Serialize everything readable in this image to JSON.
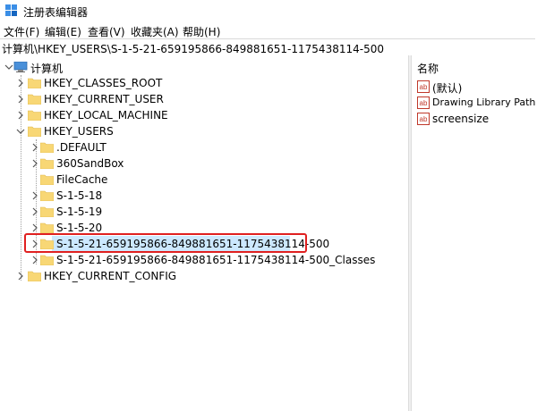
{
  "window": {
    "title": "注册表编辑器"
  },
  "menu": [
    "文件(F)",
    "编辑(E)",
    "查看(V)",
    "收藏夹(A)",
    "帮助(H)"
  ],
  "address": "计算机\\HKEY_USERS\\S-1-5-21-659195866-849881651-1175438114-500",
  "tree": {
    "root": "计算机",
    "hkeys": [
      "HKEY_CLASSES_ROOT",
      "HKEY_CURRENT_USER",
      "HKEY_LOCAL_MACHINE",
      "HKEY_USERS"
    ],
    "users_children": [
      ".DEFAULT",
      "360SandBox",
      "FileCache",
      "S-1-5-18",
      "S-1-5-19",
      "S-1-5-20",
      "S-1-5-21-659195866-849881651-1175438114-500",
      "S-1-5-21-659195866-849881651-1175438114-500_Classes"
    ],
    "last_hkey": "HKEY_CURRENT_CONFIG"
  },
  "values_pane": {
    "header": "名称",
    "items": [
      "(默认)",
      "Drawing Library Path",
      "screensize"
    ]
  },
  "colors": {
    "selection": "#cce8ff",
    "highlight_border": "#e02020",
    "folder": "#f8d775",
    "ab_icon": "#c0392b"
  }
}
